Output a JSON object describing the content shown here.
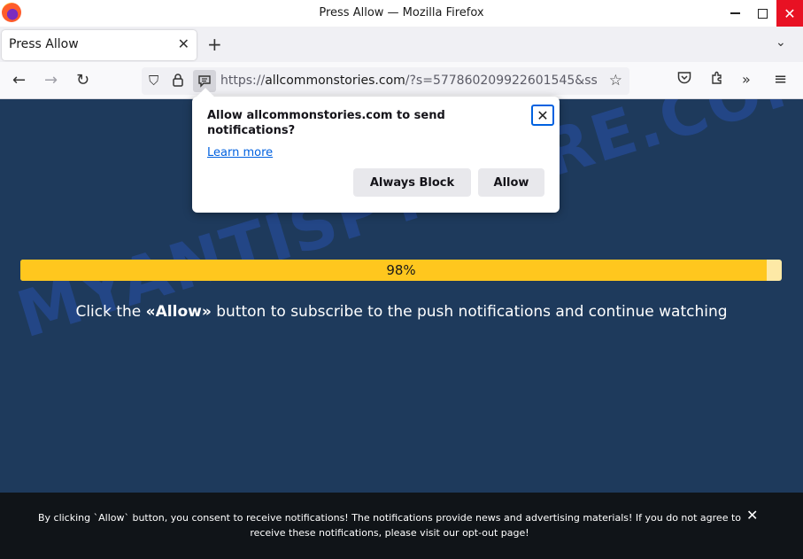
{
  "window": {
    "title": "Press Allow — Mozilla Firefox",
    "minimize_glyph": "",
    "close_glyph": "✕"
  },
  "tabs": [
    {
      "title": "Press Allow",
      "close_glyph": "✕"
    }
  ],
  "tabstrip": {
    "new_tab_glyph": "+",
    "list_all_glyph": "⌄"
  },
  "nav": {
    "back_glyph": "←",
    "forward_glyph": "→",
    "reload_glyph": "↻",
    "url_prefix": "https://",
    "url_domain": "allcommonstories.com",
    "url_rest": "/?s=577860209922601545&ss",
    "icons": [
      "shield-icon",
      "lock-icon",
      "notification-permission-icon",
      "bookmark-star-icon",
      "pocket-icon",
      "extensions-icon",
      "overflow-icon",
      "menu-icon"
    ]
  },
  "toolbar": {
    "shield_glyph": "⛉",
    "lock_glyph": "🔒",
    "perm_glyph": "▤",
    "star_glyph": "☆",
    "pocket_glyph": "♡",
    "ext_glyph": "⧉",
    "more_glyph": "»",
    "menu_glyph": "≡"
  },
  "popup": {
    "message": "Allow allcommonstories.com to send notifications?",
    "learn_more": "Learn more",
    "close_glyph": "✕",
    "block_label": "Always Block",
    "allow_label": "Allow"
  },
  "page": {
    "progress_percent": 98,
    "progress_label": "98%",
    "cta_before": "Click the ",
    "cta_bold": "«Allow»",
    "cta_after": " button to subscribe to the push notifications and continue watching",
    "watermark": "MYANTISPYWARE.COM"
  },
  "banner": {
    "text_before": "By clicking `Allow` button, you consent to receive notifications! The notifications provide news and advertising materials! If you do not agree to receive these notifications, please visit our ",
    "link_text": "opt-out page",
    "text_after": "!",
    "close_glyph": "✕"
  },
  "colors": {
    "page_bg": "#1e3a5c",
    "progress_fill": "#ffc71e",
    "progress_track": "#fde9a6",
    "link": "#0061e0",
    "close_red": "#e81123"
  }
}
